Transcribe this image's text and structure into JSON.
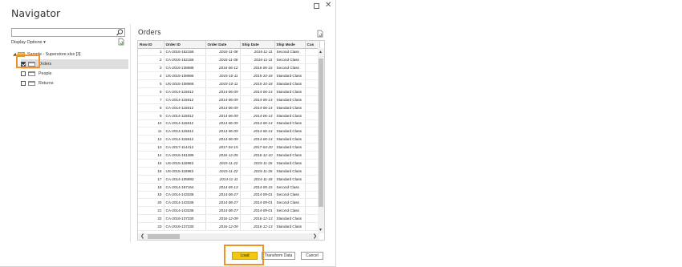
{
  "window": {
    "title": "Navigator",
    "maximize_icon": "maximize-icon",
    "close_icon": "close-icon"
  },
  "left_panel": {
    "search": {
      "value": "",
      "placeholder": ""
    },
    "display_options": "Display Options",
    "display_options_arrow": "▾",
    "tree": {
      "root": {
        "label": "Sample - Superstore.xlsx [3]"
      },
      "items": [
        {
          "label": "Orders",
          "checked": true,
          "selected": true
        },
        {
          "label": "People",
          "checked": false,
          "selected": false
        },
        {
          "label": "Returns",
          "checked": false,
          "selected": false
        }
      ]
    }
  },
  "preview": {
    "title": "Orders",
    "columns": [
      "Row ID",
      "Order ID",
      "Order Date",
      "Ship Date",
      "Ship Mode",
      "Cus"
    ],
    "rows": [
      [
        "1",
        "CA-2016-152156",
        "2016-11-08",
        "2016-11-11",
        "Second Class"
      ],
      [
        "2",
        "CA-2016-152156",
        "2016-11-08",
        "2016-11-11",
        "Second Class"
      ],
      [
        "3",
        "CA-2016-138688",
        "2016-06-12",
        "2016-06-16",
        "Second Class"
      ],
      [
        "4",
        "US-2015-108966",
        "2015-10-11",
        "2015-10-18",
        "Standard Class"
      ],
      [
        "5",
        "US-2015-108966",
        "2015-10-11",
        "2015-10-18",
        "Standard Class"
      ],
      [
        "6",
        "CA-2014-115812",
        "2014-06-09",
        "2014-06-14",
        "Standard Class"
      ],
      [
        "7",
        "CA-2014-115812",
        "2014-06-09",
        "2014-06-14",
        "Standard Class"
      ],
      [
        "8",
        "CA-2014-115812",
        "2014-06-09",
        "2014-06-14",
        "Standard Class"
      ],
      [
        "9",
        "CA-2014-115812",
        "2014-06-09",
        "2014-06-14",
        "Standard Class"
      ],
      [
        "10",
        "CA-2014-115812",
        "2014-06-09",
        "2014-06-14",
        "Standard Class"
      ],
      [
        "11",
        "CA-2014-115812",
        "2014-06-09",
        "2014-06-14",
        "Standard Class"
      ],
      [
        "12",
        "CA-2014-115812",
        "2014-06-09",
        "2014-06-14",
        "Standard Class"
      ],
      [
        "13",
        "CA-2017-114412",
        "2017-04-15",
        "2017-04-20",
        "Standard Class"
      ],
      [
        "14",
        "CA-2016-161389",
        "2016-12-05",
        "2016-12-10",
        "Standard Class"
      ],
      [
        "15",
        "US-2015-118983",
        "2015-11-22",
        "2015-11-26",
        "Standard Class"
      ],
      [
        "16",
        "US-2015-118983",
        "2015-11-22",
        "2015-11-26",
        "Standard Class"
      ],
      [
        "17",
        "CA-2014-105893",
        "2014-11-11",
        "2014-11-18",
        "Standard Class"
      ],
      [
        "18",
        "CA-2014-167164",
        "2014-05-13",
        "2014-05-15",
        "Second Class"
      ],
      [
        "19",
        "CA-2014-143336",
        "2014-08-27",
        "2014-09-01",
        "Second Class"
      ],
      [
        "20",
        "CA-2014-143336",
        "2014-08-27",
        "2014-09-01",
        "Second Class"
      ],
      [
        "21",
        "CA-2014-143336",
        "2014-08-27",
        "2014-09-01",
        "Second Class"
      ],
      [
        "22",
        "CA-2016-137330",
        "2016-12-09",
        "2016-12-13",
        "Standard Class"
      ],
      [
        "23",
        "CA-2016-137330",
        "2016-12-09",
        "2016-12-13",
        "Standard Class"
      ]
    ]
  },
  "footer": {
    "load_label": "Load",
    "transform_label": "Transform Data",
    "cancel_label": "Cancel"
  },
  "colors": {
    "load_button": "#f2c811",
    "highlight": "#f0922a"
  }
}
